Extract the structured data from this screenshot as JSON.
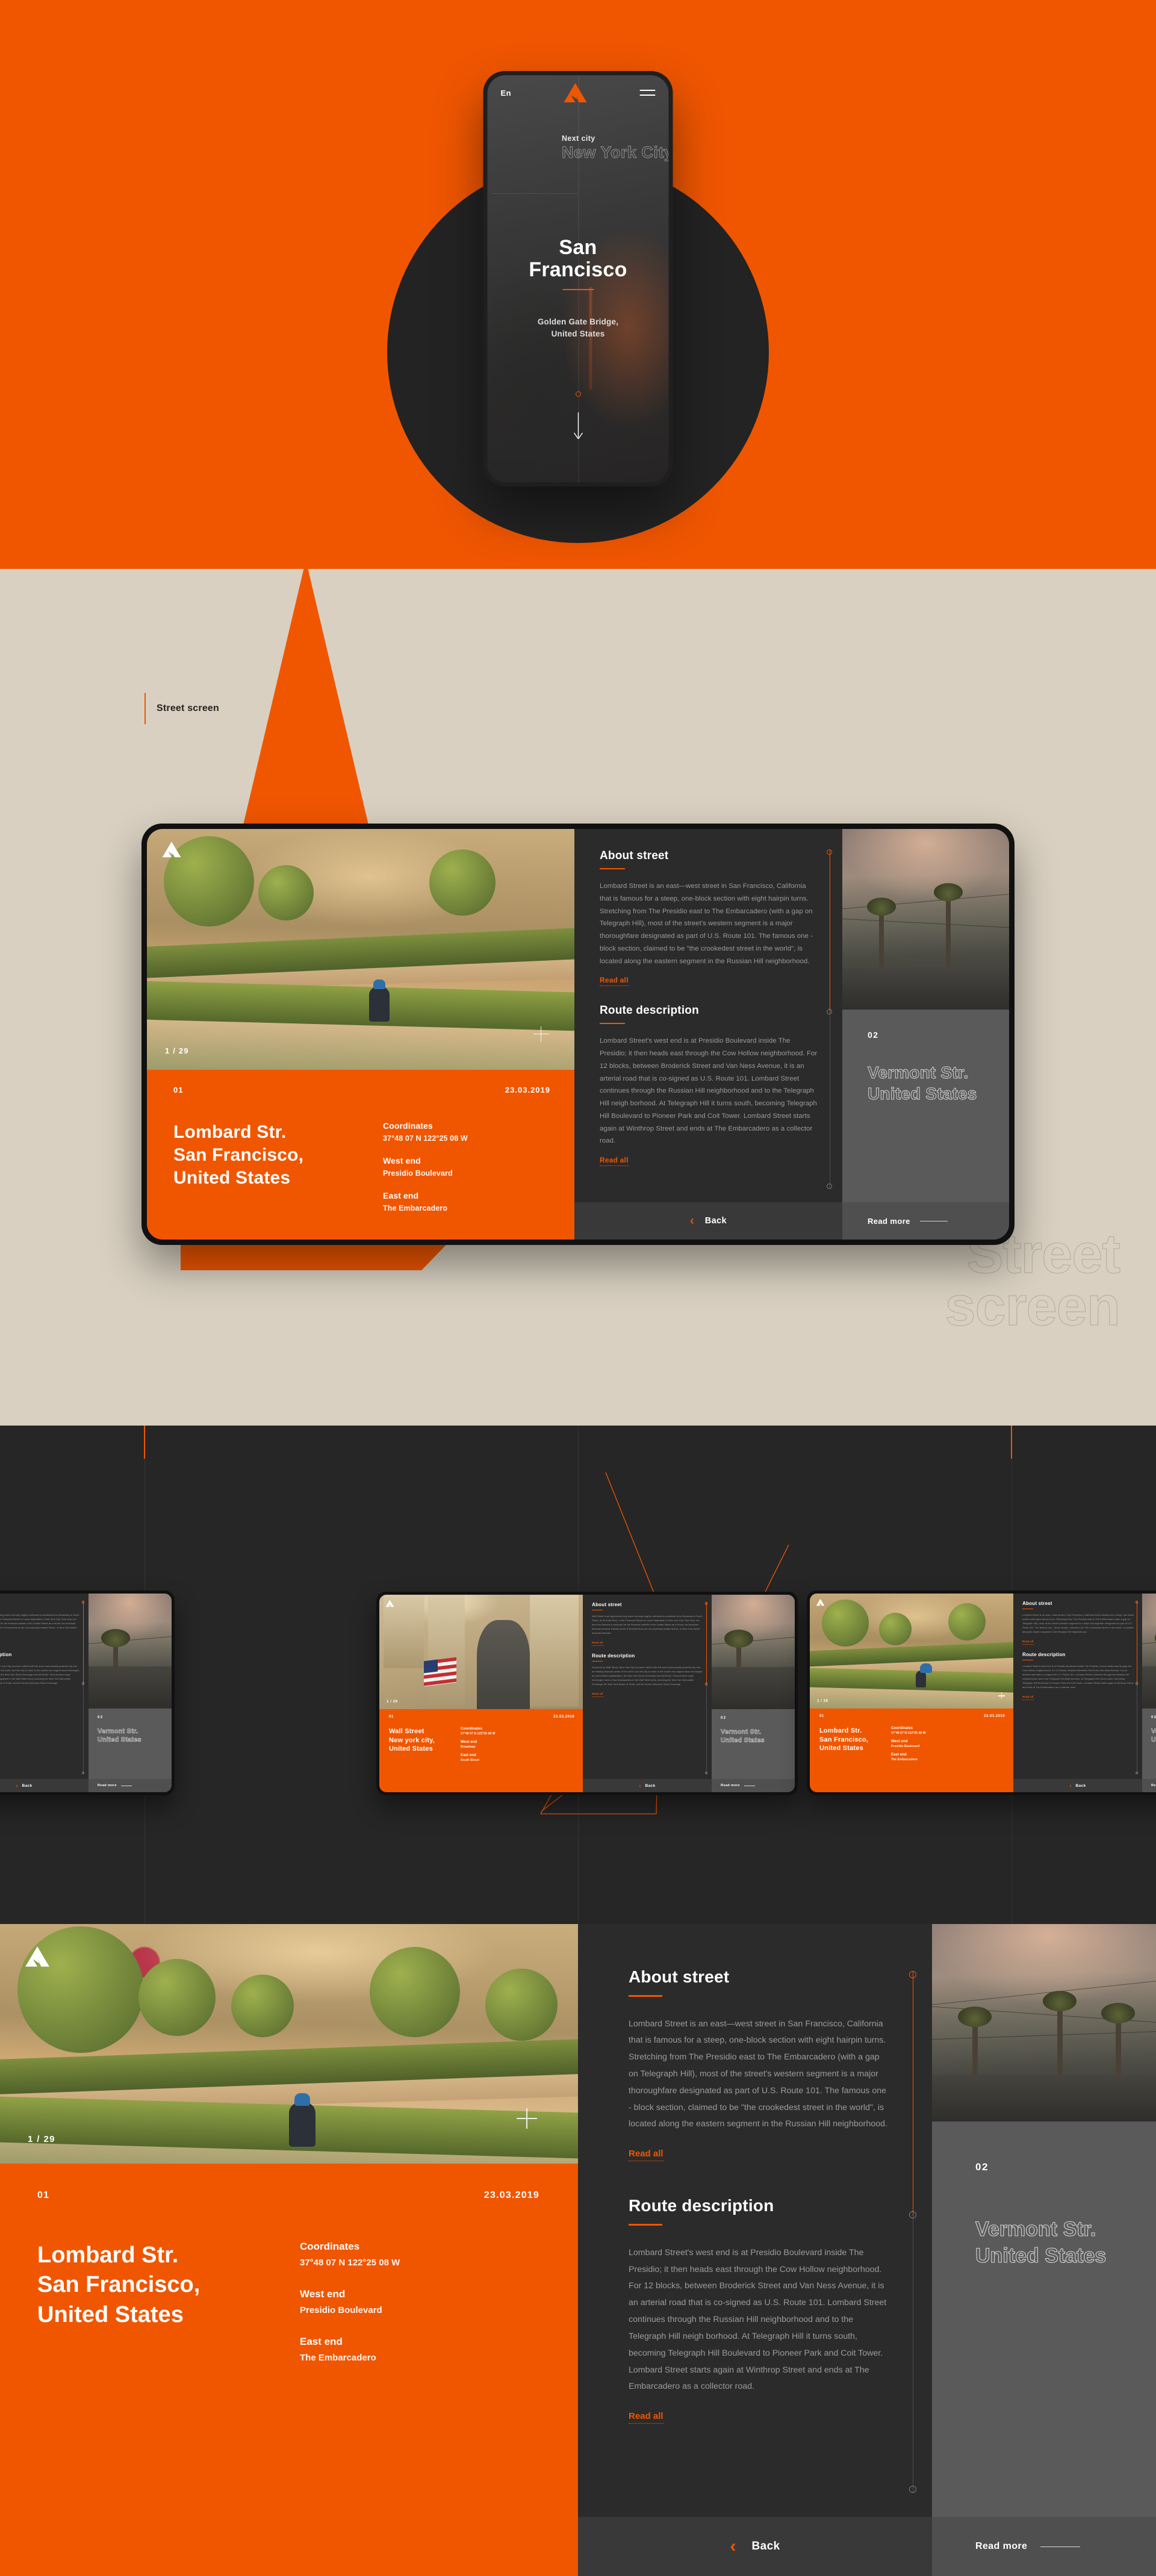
{
  "brand": {
    "logo_alt": "arrow-logo"
  },
  "hero": {
    "language": "En",
    "menu_label": "menu",
    "next_city_label": "Next city",
    "next_city_name": "New York City",
    "city": "San\nFrancisco",
    "city_line1": "San",
    "city_line2": "Francisco",
    "subtitle": "Golden Gate Bridge,\nUnited States",
    "subtitle_line1": "Golden Gate Bridge,",
    "subtitle_line2": "United States",
    "scroll_hint": "scroll-down-arrow"
  },
  "section_street": {
    "label": "Street screen",
    "watermark_line1": "Street",
    "watermark_line2": "screen"
  },
  "card_lombard": {
    "counter": "1 / 29",
    "number": "01",
    "date": "23.03.2019",
    "title_line1": "Lombard Str.",
    "title_line2": "San Francisco,",
    "title_line3": "United States",
    "specs": [
      {
        "key": "Coordinates",
        "value": "37°48 07 N 122°25 08 W"
      },
      {
        "key": "West end",
        "value": "Presidio Boulevard"
      },
      {
        "key": "East end",
        "value": "The Embarcadero"
      }
    ],
    "about_heading": "About street",
    "about_text": "Lombard Street is an east—west street in San Francisco, California that is famous for a steep, one-block section with eight hairpin turns. Stretching from The Presidio east to The Embarcadero (with a gap on Telegraph Hill), most of the street's western segment is a major thoroughfare designated as part of U.S. Route 101. The famous one - block section, claimed to be \"the crookedest street in the world\", is located along the eastern segment in the Russian Hill neighborhood.",
    "route_heading": "Route description",
    "route_text": "Lombard Street's west end is at Presidio Boulevard inside The Presidio; it then heads east through the Cow Hollow neighborhood. For 12 blocks, between Broderick Street and Van Ness Avenue, it is an arterial road that is co-signed as U.S. Route 101. Lombard Street continues through the Russian Hill neighborhood and to the Telegraph Hill neigh borhood. At Telegraph Hill it turns south, becoming Telegraph Hill Boulevard to Pioneer Park and Coit Tower. Lombard Street starts again at Winthrop Street and ends at The Embarcadero as a collector road.",
    "read_all": "Read all",
    "back": "Back"
  },
  "card_wall": {
    "counter": "1 / 29",
    "number": "01",
    "date": "23.03.2019",
    "title_line1": "Wall Street",
    "title_line2": "New york city,",
    "title_line3": "United States",
    "specs": [
      {
        "key": "Coordinates",
        "value": "37°48 07 N 122°25 08 W"
      },
      {
        "key": "West end",
        "value": "Broadway"
      },
      {
        "key": "East end",
        "value": "South Street"
      }
    ],
    "about_heading": "About street",
    "about_text": "Wall Street is an eight-block-long street running roughly northwest to southeast from Broadway to South Street, at the East River, in the Financial District of Lower Manhattan in New York City. Over time, the term has become a metonym for the financial markets of the United States as a whole, the American financial services industry (even if financial firms are not physically located there), or New York-based financial interests.",
    "route_heading": "Route description",
    "route_text": "Anchored by Wall Street, New York City has been called both the most economically powerful city and the leading financial center of the world, and the city is home to the world's two largest stock exchanges by total market capitalization, the New York Stock Exchange and NASDAQ. Several other major exchanges have or had headquarters in the Wall Street area, including the New York Mercantile Exchange, the New York Board of Trade, and the former American Stock Exchange.",
    "read_all": "Read all",
    "back": "Back"
  },
  "next_card": {
    "number": "02",
    "name_line1": "Vermont Str.",
    "name_line2": "United States",
    "read_more": "Read more"
  },
  "colors": {
    "accent": "#F05600",
    "beige": "#D9D0C1",
    "dark": "#262626",
    "panel": "#2B2B2B",
    "panel_alt": "#393939",
    "next_panel": "#5A5A5A"
  }
}
